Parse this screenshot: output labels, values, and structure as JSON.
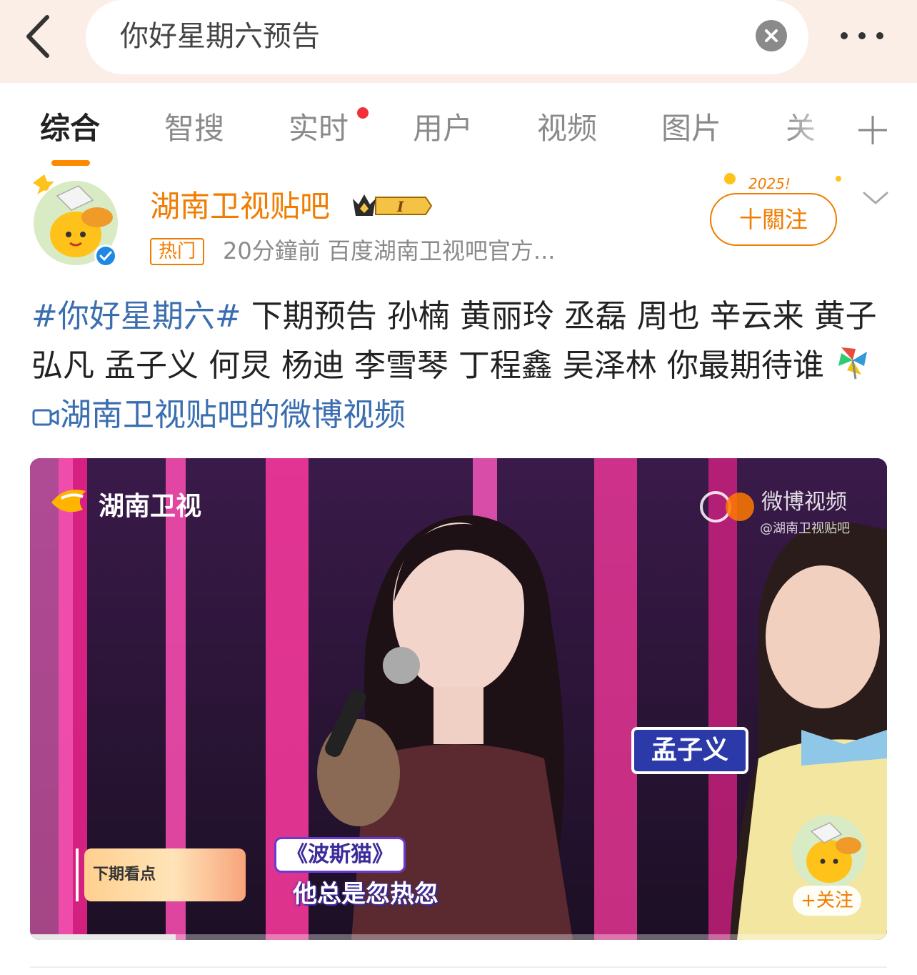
{
  "search": {
    "query": "你好星期六预告"
  },
  "tabs": [
    {
      "label": "综合",
      "active": true
    },
    {
      "label": "智搜"
    },
    {
      "label": "实时",
      "has_dot": true
    },
    {
      "label": "用户"
    },
    {
      "label": "视频"
    },
    {
      "label": "图片"
    },
    {
      "label": "关"
    }
  ],
  "post": {
    "author": "湖南卫视贴吧",
    "badge_level": "I",
    "hot_tag": "热门",
    "time": "20分鐘前",
    "source": "百度湖南卫视吧官方...",
    "follow_label": "十關注",
    "hashtag": "#你好星期六#",
    "body": " 下期预告 孙楠 黄丽玲 丞磊 周也 辛云来 黄子弘凡 孟子义 何炅 杨迪 李雪琴 丁程鑫 吴泽林 你最期待谁",
    "video_link": "湖南卫视贴吧的微博视频"
  },
  "video": {
    "channel": "湖南卫视",
    "watermark": "微博视频",
    "watermark_sub": "@湖南卫视贴吧",
    "name_card": "孟子义",
    "next_label": "下期看点",
    "song_title": "《波斯猫》",
    "subtitle": "他总是忽热忽",
    "follow_overlay": "+关注",
    "progress": 0.17
  },
  "colors": {
    "accent": "#f07c00",
    "link": "#3a6eb0",
    "header_bg": "#fbeee6",
    "tab_underline": "#ff8a00",
    "notification_dot": "#f2303a"
  }
}
